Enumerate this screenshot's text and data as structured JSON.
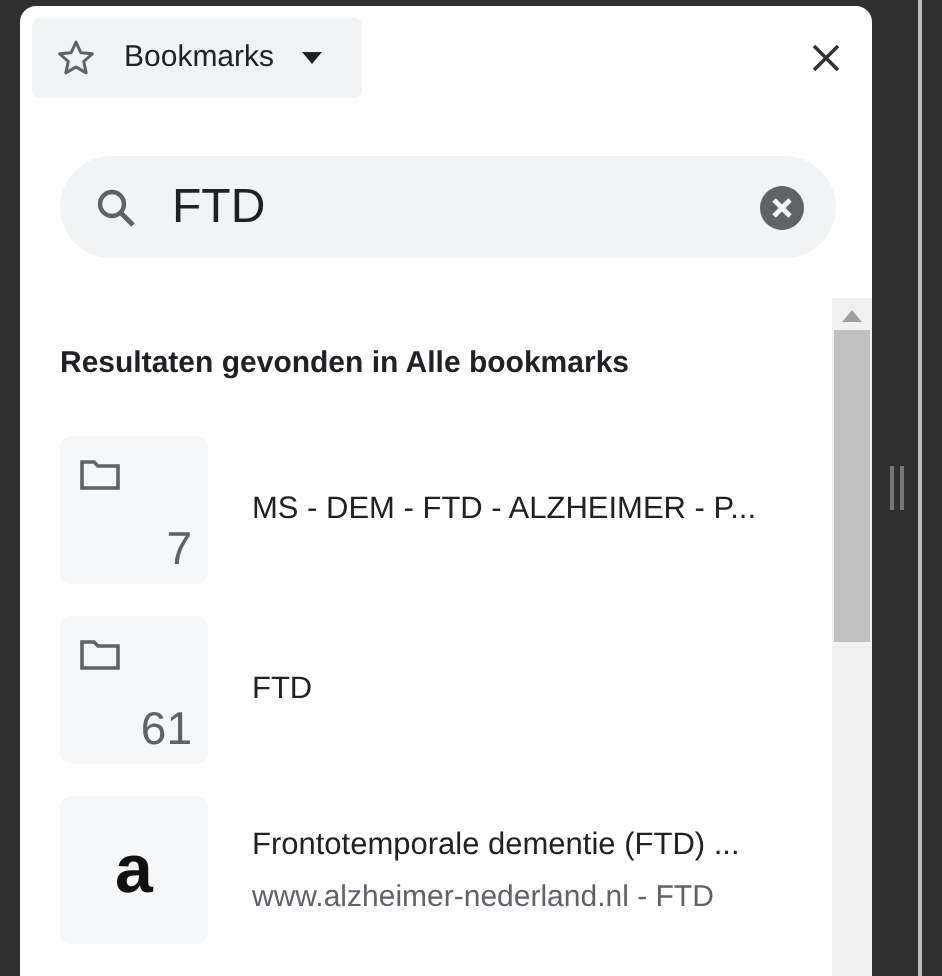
{
  "header": {
    "menu_label": "Bookmarks"
  },
  "search": {
    "value": "FTD"
  },
  "results_heading": "Resultaten gevonden in Alle bookmarks",
  "items": [
    {
      "kind": "folder",
      "count": "7",
      "title": "MS - DEM - FTD - ALZHEIMER - P..."
    },
    {
      "kind": "folder",
      "count": "61",
      "title": "FTD"
    },
    {
      "kind": "page",
      "favicon": "a",
      "title": "Frontotemporale dementie (FTD) ...",
      "url": "www.alzheimer-nederland.nl - FTD"
    }
  ]
}
